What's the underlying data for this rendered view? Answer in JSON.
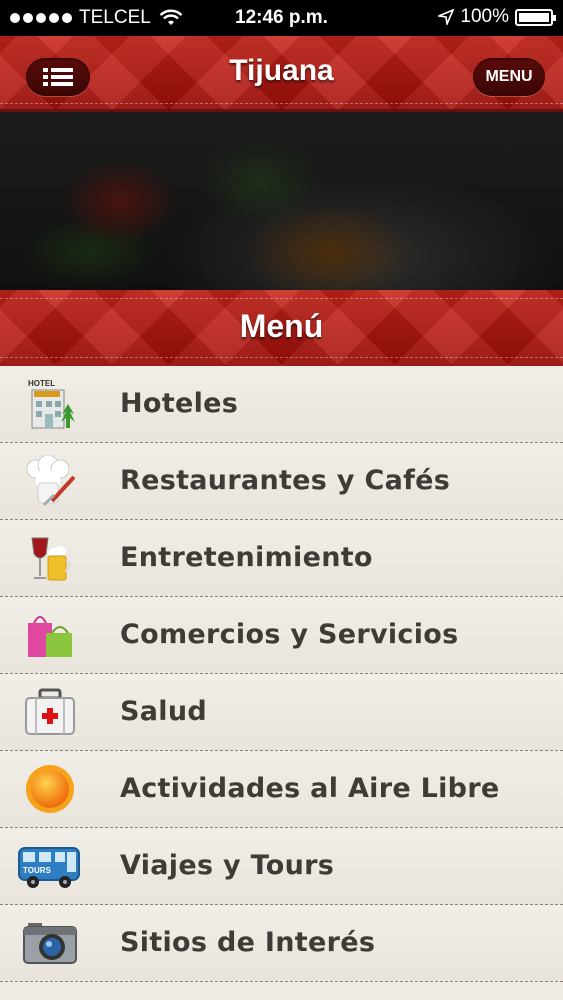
{
  "status_bar": {
    "carrier": "TELCEL",
    "time": "12:46 p.m.",
    "battery": "100%"
  },
  "navbar": {
    "title": "Tijuana",
    "menu_button": "MENU"
  },
  "section": {
    "title": "Menú"
  },
  "menu_items": [
    {
      "label": "Hoteles",
      "icon": "hotel-icon"
    },
    {
      "label": "Restaurantes y Cafés",
      "icon": "chef-hat-icon"
    },
    {
      "label": "Entretenimiento",
      "icon": "drinks-icon"
    },
    {
      "label": "Comercios y Servicios",
      "icon": "shopping-bags-icon"
    },
    {
      "label": "Salud",
      "icon": "first-aid-kit-icon"
    },
    {
      "label": "Actividades al Aire Libre",
      "icon": "sun-icon"
    },
    {
      "label": "Viajes y Tours",
      "icon": "tour-bus-icon"
    },
    {
      "label": "Sitios de Interés",
      "icon": "camera-icon"
    }
  ],
  "hotel_sign_text": "HOTEL",
  "bus_sign_text": "TOURS",
  "colors": {
    "accent_red": "#b3140e",
    "text_dark": "#3f3b36",
    "list_bg": "#efece4"
  }
}
